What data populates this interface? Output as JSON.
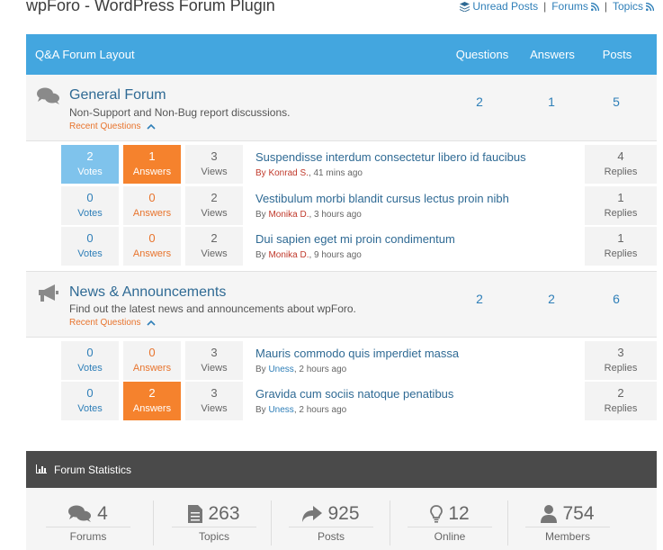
{
  "page": {
    "title": "wpForo - WordPress Forum Plugin",
    "links": {
      "unread": "Unread Posts",
      "forums": "Forums",
      "topics": "Topics",
      "sep": "|"
    }
  },
  "layout_header": {
    "title": "Q&A Forum Layout",
    "questions": "Questions",
    "answers": "Answers",
    "posts": "Posts"
  },
  "forums": [
    {
      "name": "General Forum",
      "description": "Non-Support and Non-Bug report discussions.",
      "recent_label": "Recent Questions",
      "questions": "2",
      "answers": "1",
      "posts": "5",
      "icon": "comments-icon",
      "topics": [
        {
          "votes": "2",
          "votes_label": "Votes",
          "answers": "1",
          "answers_label": "Answers",
          "views": "3",
          "views_label": "Views",
          "title": "Suspendisse interdum consectetur libero id faucibus",
          "by": "By",
          "author": "Konrad S.",
          "time": ", 41 mins ago",
          "replies": "4",
          "replies_label": "Replies"
        },
        {
          "votes": "0",
          "votes_label": "Votes",
          "answers": "0",
          "answers_label": "Answers",
          "views": "2",
          "views_label": "Views",
          "title": "Vestibulum morbi blandit cursus lectus proin nibh",
          "by": "By",
          "author": "Monika D.",
          "time": ", 3 hours ago",
          "replies": "1",
          "replies_label": "Replies"
        },
        {
          "votes": "0",
          "votes_label": "Votes",
          "answers": "0",
          "answers_label": "Answers",
          "views": "2",
          "views_label": "Views",
          "title": "Dui sapien eget mi proin condimentum",
          "by": "By",
          "author": "Monika D.",
          "time": ", 9 hours ago",
          "replies": "1",
          "replies_label": "Replies"
        }
      ]
    },
    {
      "name": "News & Announcements",
      "description": "Find out the latest news and announcements about wpForo.",
      "recent_label": "Recent Questions",
      "questions": "2",
      "answers": "2",
      "posts": "6",
      "icon": "bullhorn-icon",
      "topics": [
        {
          "votes": "0",
          "votes_label": "Votes",
          "answers": "0",
          "answers_label": "Answers",
          "views": "3",
          "views_label": "Views",
          "title": "Mauris commodo quis imperdiet massa",
          "by": "By",
          "author": "Uness",
          "time": ", 2 hours ago",
          "replies": "3",
          "replies_label": "Replies"
        },
        {
          "votes": "0",
          "votes_label": "Votes",
          "answers": "2",
          "answers_label": "Answers",
          "views": "3",
          "views_label": "Views",
          "title": "Gravida cum sociis natoque penatibus",
          "by": "By",
          "author": "Uness",
          "time": ", 2 hours ago",
          "replies": "2",
          "replies_label": "Replies"
        }
      ]
    }
  ],
  "statistics": {
    "title": "Forum Statistics",
    "items": [
      {
        "value": "4",
        "label": "Forums",
        "icon": "comments-icon"
      },
      {
        "value": "263",
        "label": "Topics",
        "icon": "document-icon"
      },
      {
        "value": "925",
        "label": "Posts",
        "icon": "reply-icon"
      },
      {
        "value": "12",
        "label": "Online",
        "icon": "lightbulb-icon"
      },
      {
        "value": "754",
        "label": "Members",
        "icon": "user-icon"
      }
    ]
  },
  "colors": {
    "header_blue": "#43a6df",
    "accent_orange": "#f5822d",
    "votes_blue": "#7fc3ec",
    "link_blue": "#2f6a94",
    "stats_dark": "#4a4a4a"
  }
}
